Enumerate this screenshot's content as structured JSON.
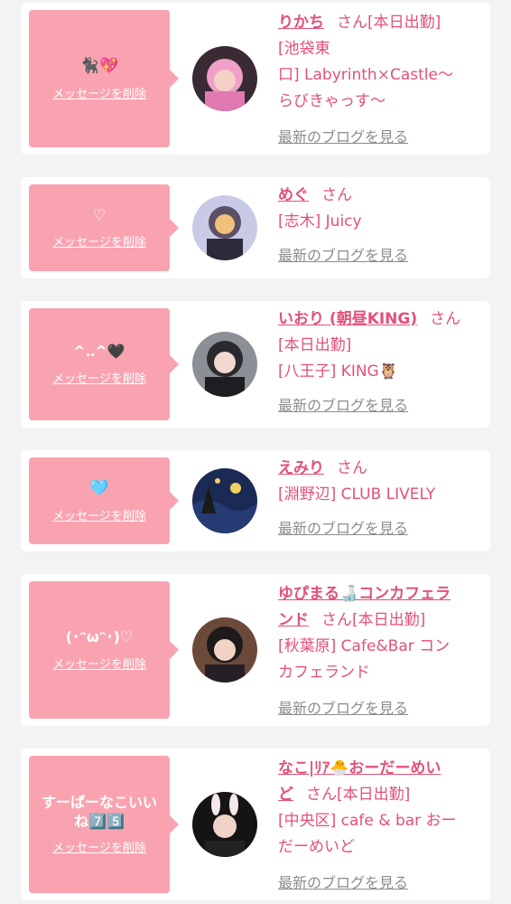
{
  "common": {
    "delete_label": "メッセージを削除",
    "san": "さん",
    "blog_label": "最新のブログを見る"
  },
  "cards": [
    {
      "message": "🐈‍⬛💖",
      "name": "りかち",
      "line1_suffix": "[本日出勤]",
      "lines": [
        "[池袋東",
        "口] Labyrinth×Castle～",
        "らびきゃっす～"
      ]
    },
    {
      "message": "♡",
      "name": "めぐ",
      "line1_suffix": "",
      "lines": [
        "[志木] Juicy"
      ]
    },
    {
      "message": "^‥^🖤",
      "name": "いおり (朝昼KING)",
      "line1_suffix": "",
      "lines": [
        "[本日出勤]",
        "[八王子] KING🦉"
      ]
    },
    {
      "message": "🩵",
      "name": "えみり",
      "line1_suffix": "",
      "lines": [
        "[淵野辺] CLUB LIVELY"
      ]
    },
    {
      "message": "(･ᵔωᵔ･)♡",
      "name_l1": "ゆぴまる🍶コンカフェラ",
      "name_l2": "ンド",
      "line1_suffix": "[本日出勤]",
      "lines": [
        "[秋葉原] Cafe&Bar コン",
        "カフェランド"
      ]
    },
    {
      "message": "すーぱーなこいい ね7️⃣5️⃣",
      "name_l1": "なこ|ﾘｱ🐣おーだーめい",
      "name_l2": "ど",
      "line1_suffix": "[本日出勤]",
      "lines": [
        "[中央区] cafe & bar おー",
        "だーめいど"
      ]
    }
  ],
  "colors": {
    "background": "#f3f3f3",
    "card": "#ffffff",
    "bubble": "#f9a3b1",
    "accent": "#e3507a",
    "muted": "#8c8c8c"
  }
}
